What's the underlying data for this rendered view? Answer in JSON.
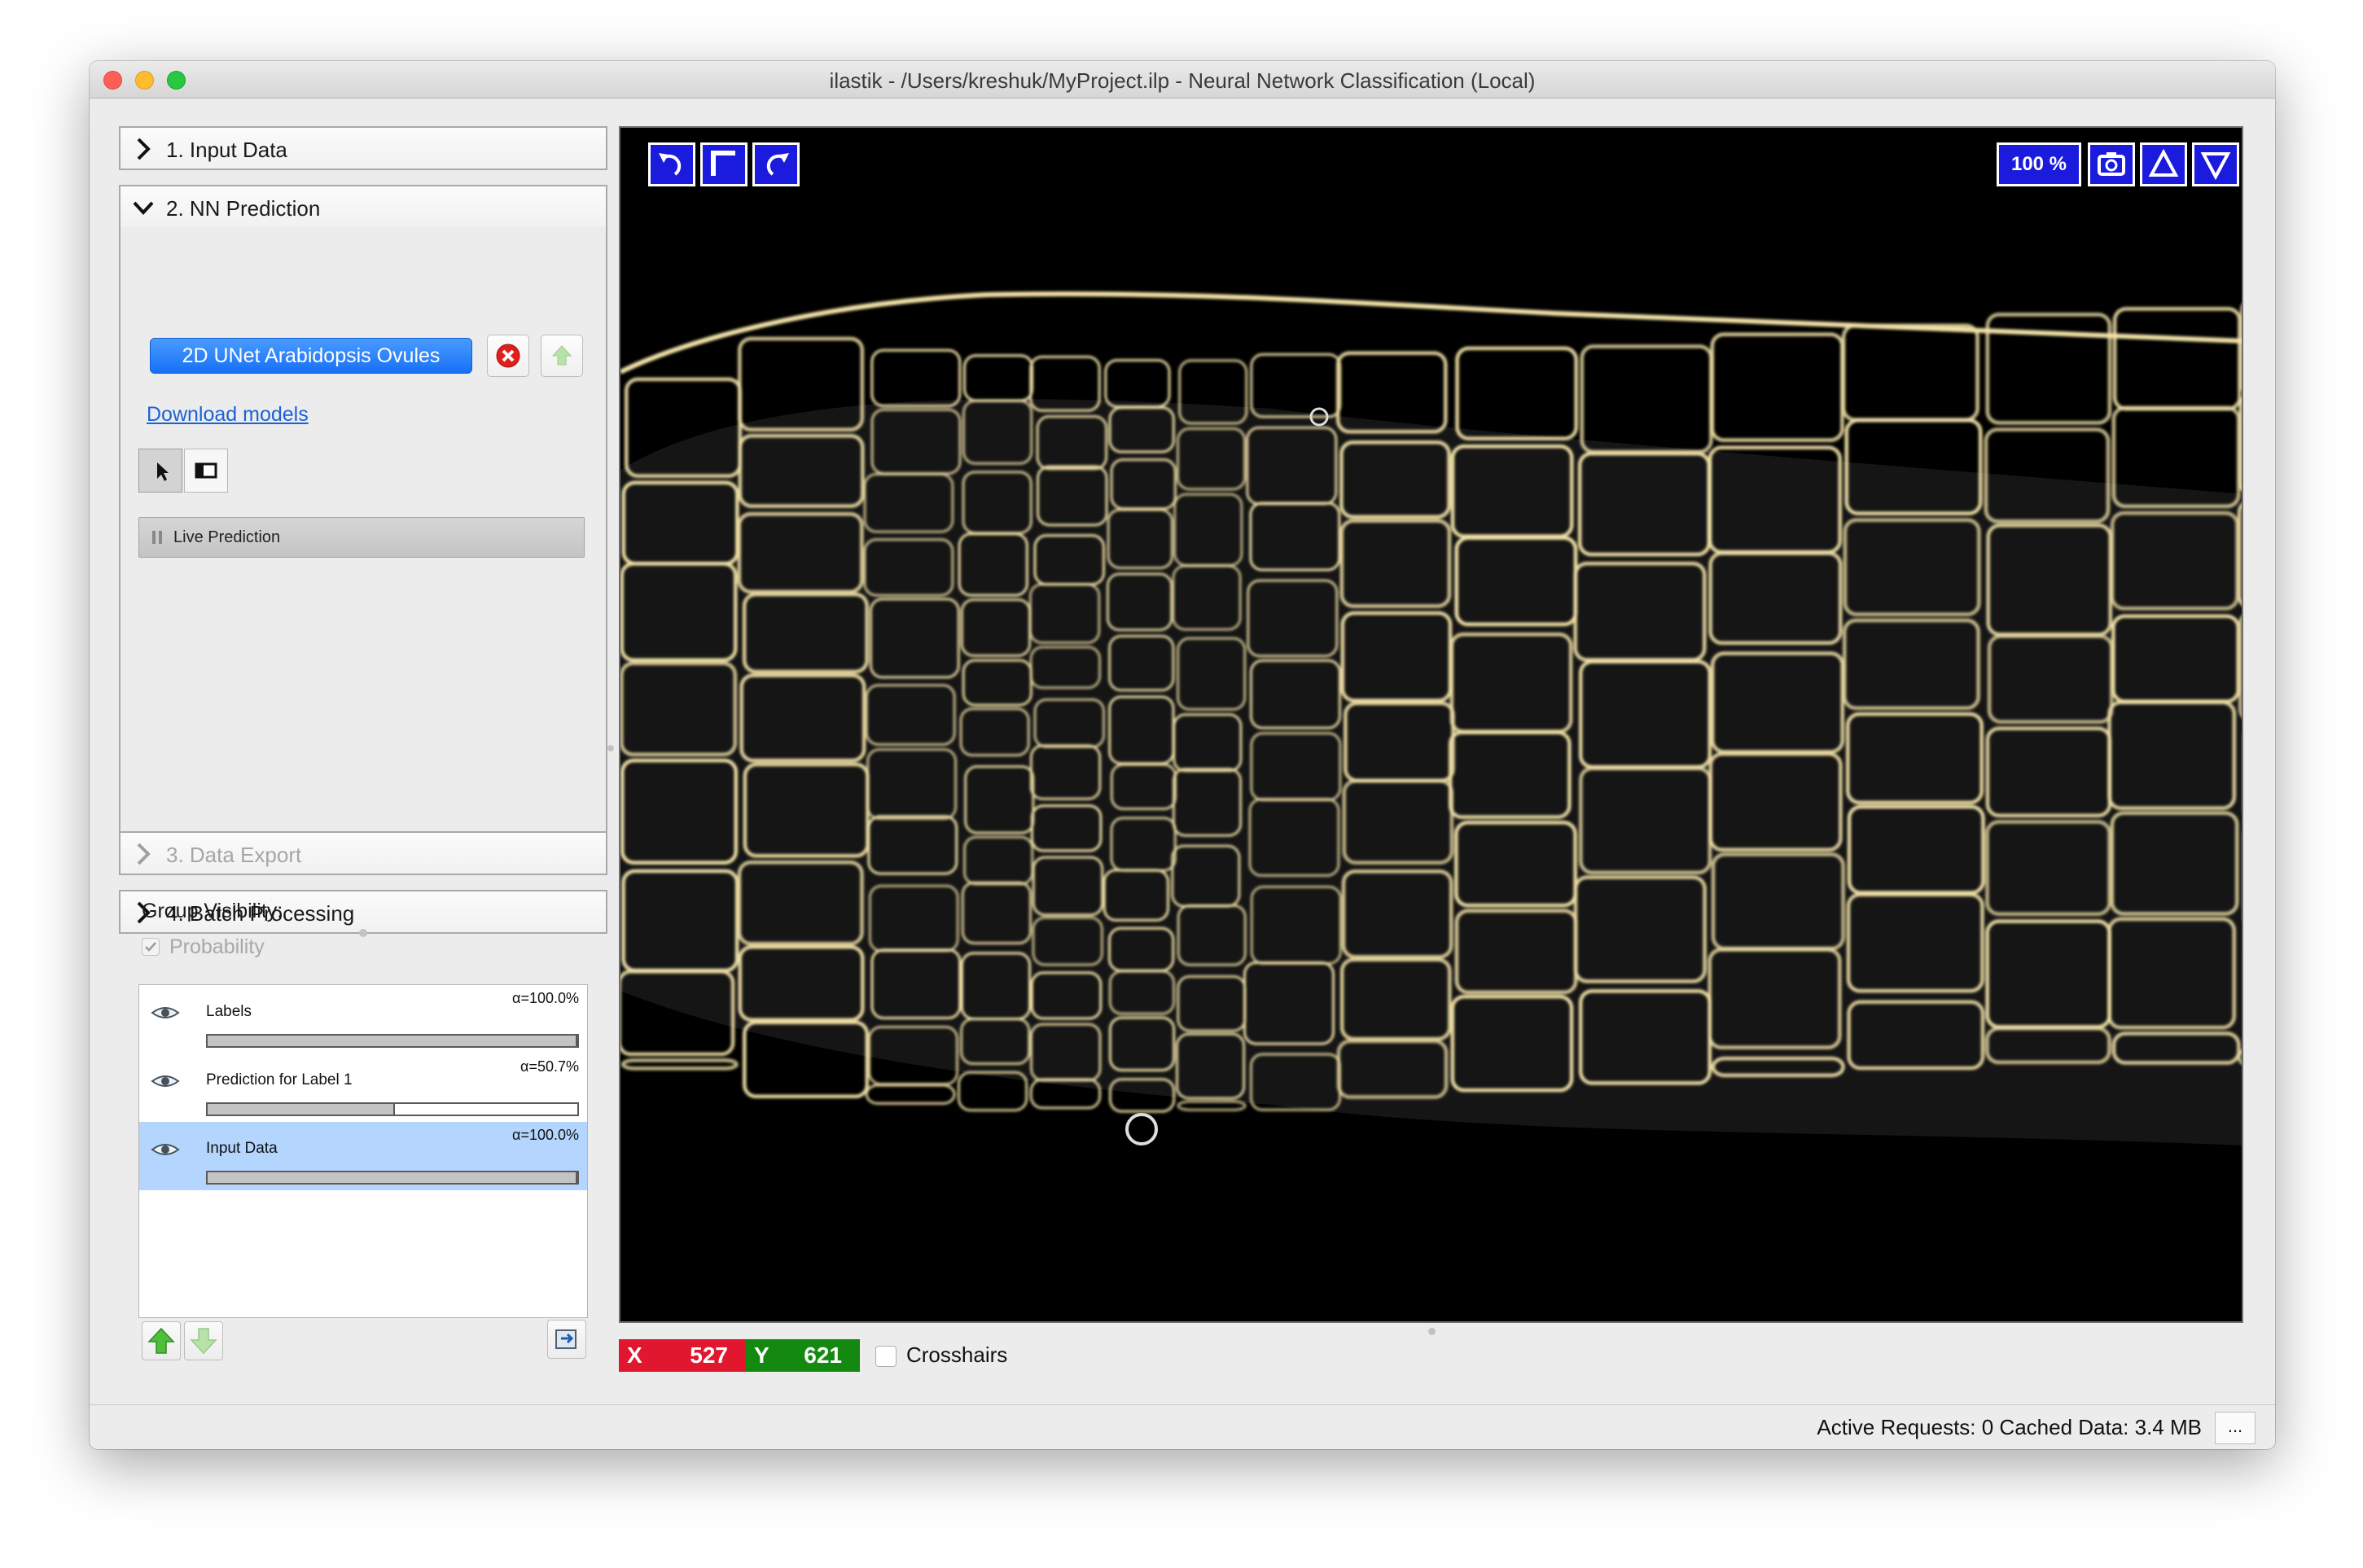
{
  "window": {
    "title": "ilastik - /Users/kreshuk/MyProject.ilp - Neural Network Classification (Local)"
  },
  "applets": {
    "input_data": "1. Input Data",
    "nn_prediction": "2. NN Prediction",
    "data_export": "3. Data Export",
    "batch_processing": "4. Batch Processing"
  },
  "nn_prediction": {
    "model_button": "2D UNet Arabidopsis Ovules",
    "download_link": "Download models",
    "live_prediction": "Live Prediction"
  },
  "group_visibility": {
    "label": "Group Visibility:",
    "probability_label": "Probability",
    "probability_checked": true
  },
  "layers": [
    {
      "name": "Labels",
      "alpha": "α=100.0%",
      "opacity": 1.0,
      "selected": false
    },
    {
      "name": "Prediction for Label 1",
      "alpha": "α=50.7%",
      "opacity": 0.507,
      "selected": false
    },
    {
      "name": "Input Data",
      "alpha": "α=100.0%",
      "opacity": 1.0,
      "selected": true
    }
  ],
  "viewer": {
    "zoom": "100 %",
    "x_label": "X",
    "x_value": "527",
    "y_label": "Y",
    "y_value": "621",
    "crosshairs_label": "Crosshairs",
    "crosshairs_checked": false
  },
  "status": {
    "text": "Active Requests: 0  Cached Data: 3.4 MB",
    "dots": "..."
  },
  "colors": {
    "model_button": "#1670f5",
    "viewer_button": "#1b1bdd",
    "x_coord": "#e0172f",
    "y_coord": "#138a0f",
    "layer_selected": "#b4d5fe",
    "cell_membrane": "#f3e3a8"
  }
}
